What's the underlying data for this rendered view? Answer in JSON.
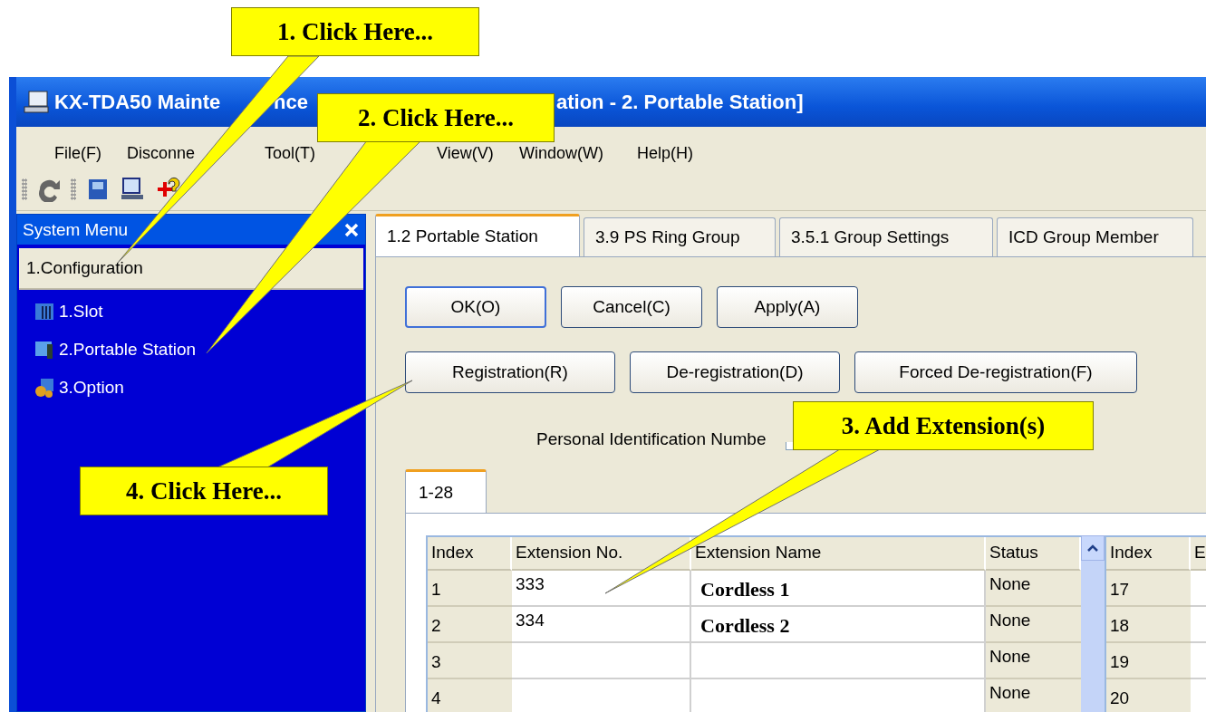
{
  "window": {
    "title_parts": [
      "KX-TDA50 Mainte",
      "nce",
      "ation - 2. Portable Station]"
    ]
  },
  "menu": [
    "File(F)",
    "Disconne",
    "Tool(T)",
    "View(V)",
    "Window(W)",
    "Help(H)"
  ],
  "sidebar": {
    "title": "System Menu",
    "group": "1.Configuration",
    "items": [
      {
        "label": "1.Slot",
        "kind": "slot"
      },
      {
        "label": "2.Portable Station",
        "kind": "portable"
      },
      {
        "label": "3.Option",
        "kind": "option"
      }
    ]
  },
  "tabs": [
    {
      "label": "1.2 Portable Station",
      "selected": true
    },
    {
      "label": "3.9 PS Ring Group",
      "selected": false
    },
    {
      "label": "3.5.1 Group Settings",
      "selected": false
    },
    {
      "label": "ICD Group Member",
      "selected": false
    }
  ],
  "buttons_row1": [
    {
      "label": "OK(O)",
      "default": true
    },
    {
      "label": "Cancel(C)",
      "default": false
    },
    {
      "label": "Apply(A)",
      "default": false
    }
  ],
  "buttons_row2": [
    {
      "label": "Registration(R)",
      "default": false
    },
    {
      "label": "De-registration(D)",
      "default": false
    },
    {
      "label": "Forced De-registration(F)",
      "default": false
    }
  ],
  "pin_label": "Personal Identification Numbe",
  "subtabs": [
    {
      "label": "1-28",
      "selected": true
    }
  ],
  "table": {
    "columns": [
      "Index",
      "Extension No.",
      "Extension Name",
      "Status"
    ],
    "rows": [
      {
        "cells": [
          "1",
          "333",
          "Cordless 1",
          "None"
        ]
      },
      {
        "cells": [
          "2",
          "334",
          "Cordless 2",
          "None"
        ]
      },
      {
        "cells": [
          "3",
          "",
          "",
          "None"
        ]
      },
      {
        "cells": [
          "4",
          "",
          "",
          "None"
        ]
      }
    ]
  },
  "table2": {
    "columns": [
      "Index",
      "E"
    ],
    "rows": [
      [
        "17"
      ],
      [
        "18"
      ],
      [
        "19"
      ],
      [
        "20"
      ]
    ]
  },
  "callouts": [
    {
      "text": "1. Click Here..."
    },
    {
      "text": "2. Click Here..."
    },
    {
      "text": "3. Add Extension(s)"
    },
    {
      "text": "4. Click Here..."
    }
  ]
}
